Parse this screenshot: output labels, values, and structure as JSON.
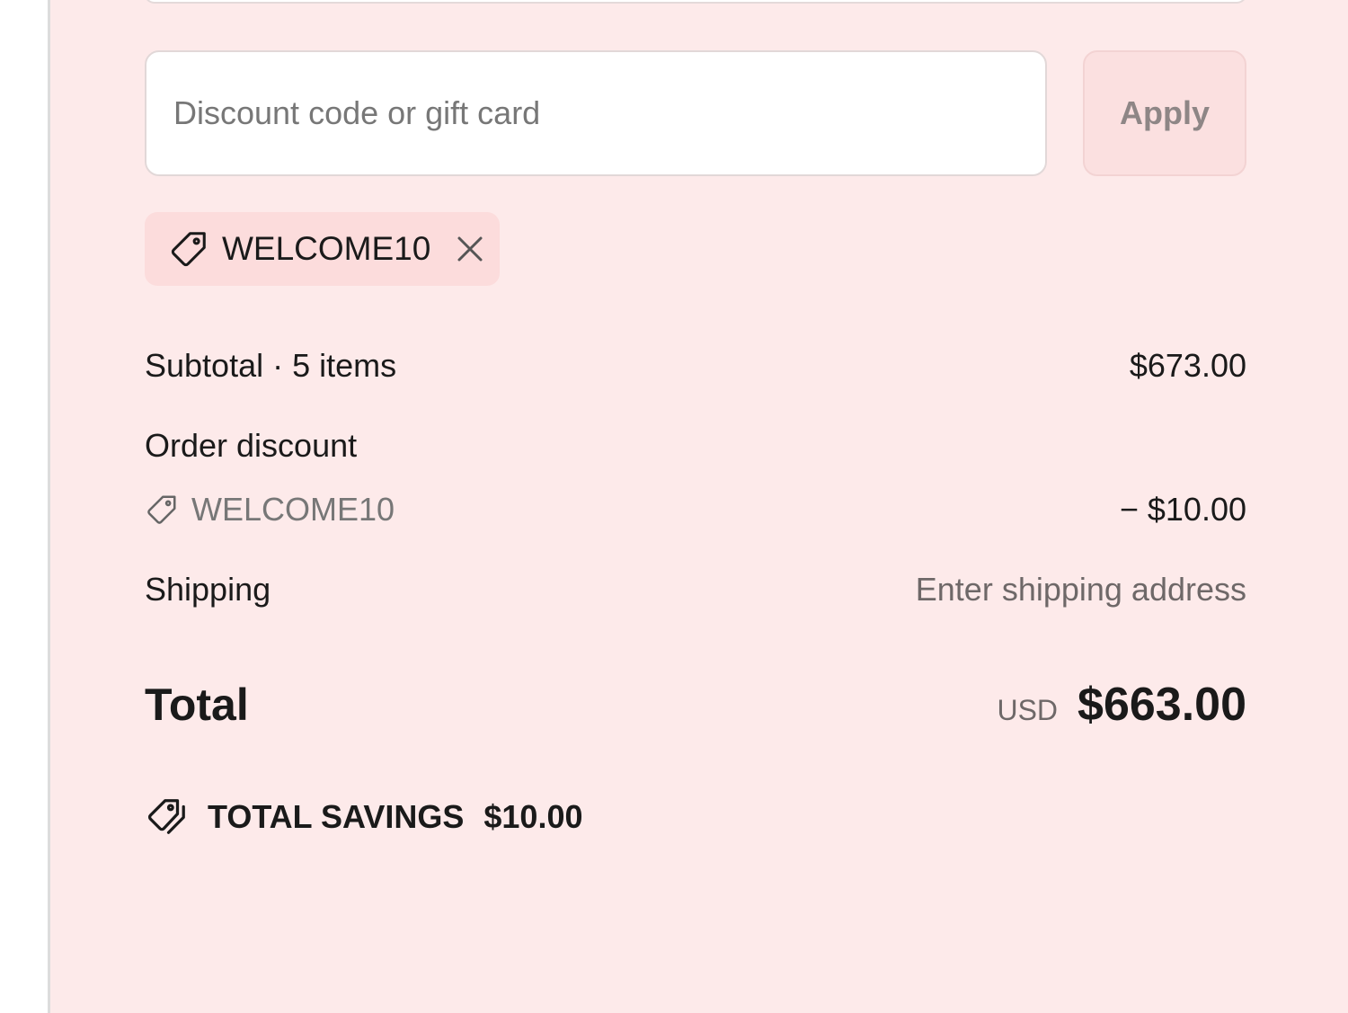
{
  "discount": {
    "placeholder": "Discount code or gift card",
    "value": "",
    "apply_label": "Apply"
  },
  "applied_code": {
    "code": "WELCOME10",
    "tag_icon": "tag-icon",
    "remove_icon": "close-icon"
  },
  "summary": {
    "subtotal_label": "Subtotal · 5 items",
    "subtotal_value": "$673.00",
    "order_discount_label": "Order discount",
    "order_discount_code": "WELCOME10",
    "order_discount_value": "− $10.00",
    "shipping_label": "Shipping",
    "shipping_value": "Enter shipping address",
    "total_label": "Total",
    "currency": "USD",
    "total_value": "$663.00"
  },
  "savings": {
    "label": "TOTAL SAVINGS",
    "amount": "$10.00",
    "icon": "tags-icon"
  },
  "colors": {
    "panel_background": "#fdeaea",
    "chip_background": "#fcdcdc",
    "apply_button_background": "#fbe0e0",
    "muted_text": "#6e6868"
  }
}
